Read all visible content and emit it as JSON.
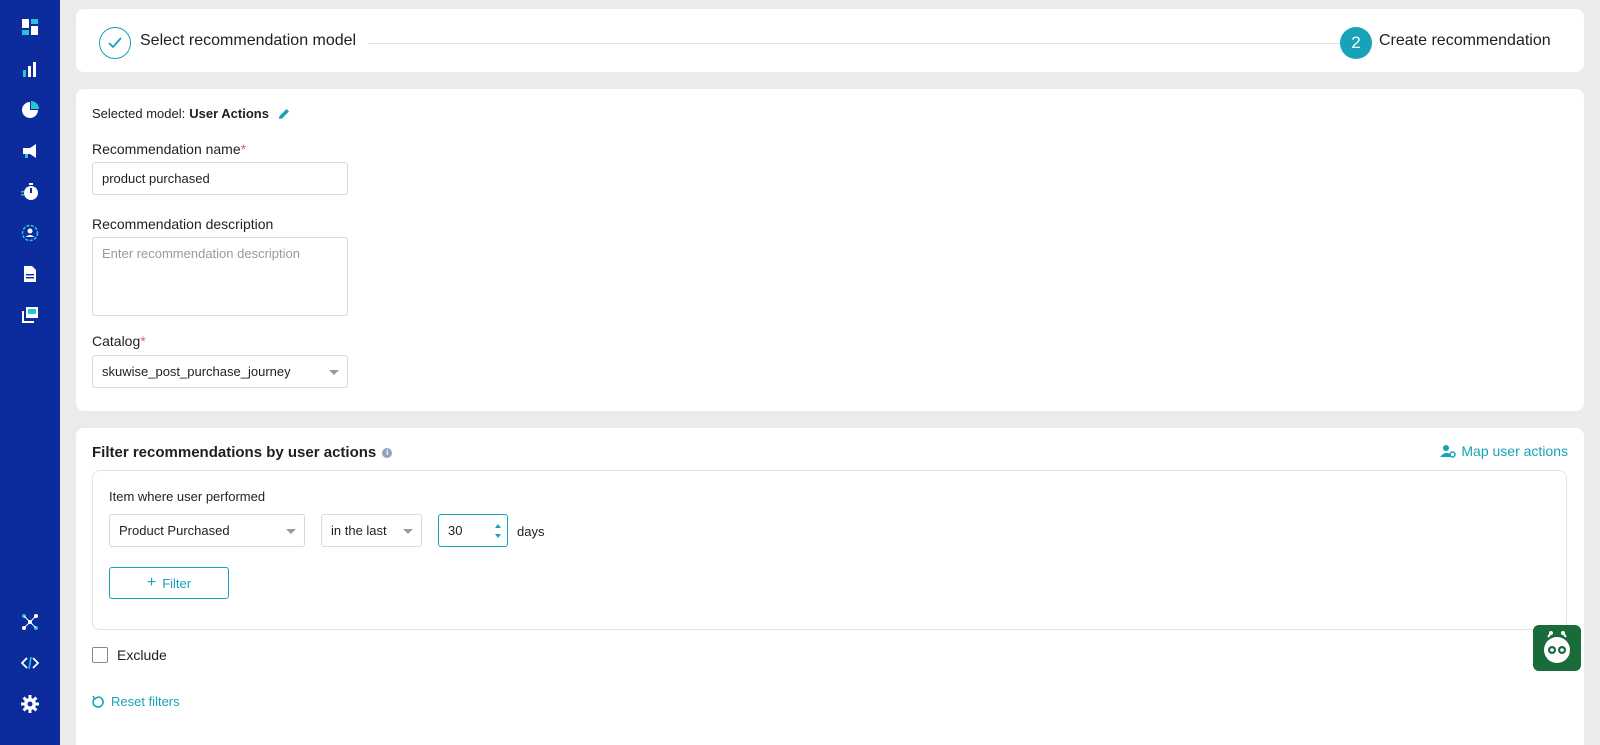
{
  "sidebar": {
    "items": [
      {
        "icon": "dashboard-icon"
      },
      {
        "icon": "analytics-bar-chart-icon"
      },
      {
        "icon": "pie-chart-icon"
      },
      {
        "icon": "campaigns-megaphone-icon"
      },
      {
        "icon": "stopwatch-icon"
      },
      {
        "icon": "user-target-icon"
      },
      {
        "icon": "document-icon"
      },
      {
        "icon": "gallery-stack-icon"
      },
      {
        "icon": "integrations-hub-icon"
      },
      {
        "icon": "code-icon"
      },
      {
        "icon": "settings-gear-icon"
      }
    ]
  },
  "stepper": {
    "step1_label": "Select recommendation model",
    "step2_number": "2",
    "step2_label": "Create recommendation"
  },
  "form": {
    "selected_model_prefix": "Selected model:",
    "selected_model_value": "User Actions",
    "name_label": "Recommendation name",
    "name_value": "product purchased",
    "description_label": "Recommendation description",
    "description_placeholder": "Enter recommendation description",
    "catalog_label": "Catalog",
    "catalog_value": "skuwise_post_purchase_journey",
    "required_marker": "*"
  },
  "filter": {
    "title": "Filter recommendations by user actions",
    "info_glyph": "i",
    "map_link": "Map user actions",
    "item_label": "Item where user performed",
    "action_value": "Product Purchased",
    "timeframe_value": "in the last",
    "days_value": "30",
    "days_unit": "days",
    "add_filter_label": "Filter",
    "exclude_label": "Exclude",
    "reset_label": "Reset filters"
  },
  "colors": {
    "sidebar": "#0c2c9e",
    "accent": "#17a2b8",
    "background": "#ebebeb",
    "bot": "#1a6b3a"
  }
}
